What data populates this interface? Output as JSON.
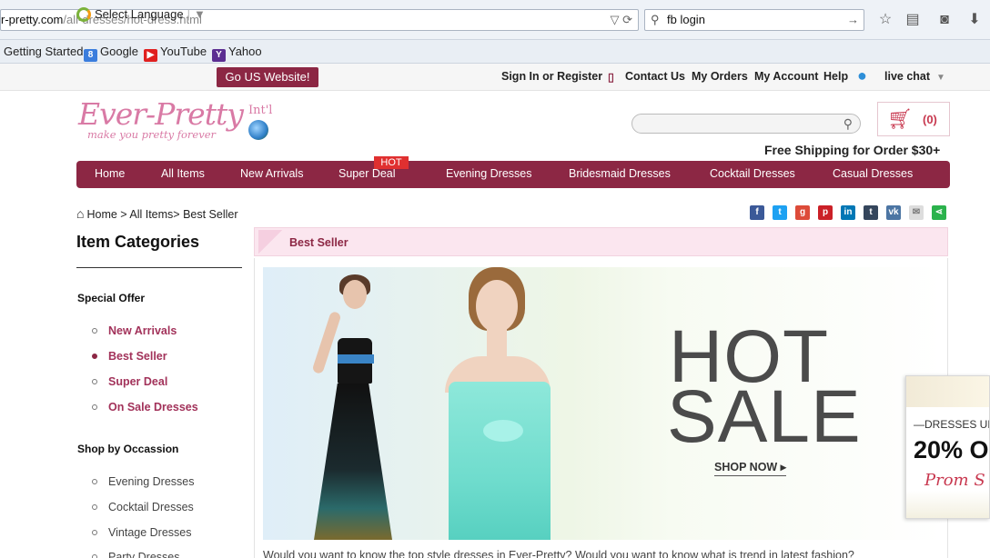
{
  "browser": {
    "url_domain": "r-pretty.com",
    "url_path": "/all-dresses/hot-dress.html",
    "search_value": "fb login",
    "bookmarks": [
      "Getting Started",
      "Google",
      "YouTube",
      "Yahoo"
    ]
  },
  "topbar": {
    "language": "Select Language",
    "go_us": "Go US Website!",
    "sign_in": "Sign In or Register",
    "contact": "Contact Us",
    "orders": "My Orders",
    "account": "My Account",
    "help": "Help",
    "live_chat": "live chat"
  },
  "header": {
    "logo": "Ever-Pretty",
    "logo_suffix": "Int'l",
    "tagline": "make you pretty forever",
    "cart_count": "(0)",
    "free_shipping": "Free Shipping for Order $30+"
  },
  "nav": {
    "items": [
      "Home",
      "All Items",
      "New Arrivals",
      "Super Deal",
      "Evening Dresses",
      "Bridesmaid Dresses",
      "Cocktail Dresses",
      "Casual Dresses"
    ],
    "hot_badge": "HOT"
  },
  "breadcrumb": {
    "home": "Home",
    "rest": " > All Items> Best Seller"
  },
  "sidebar": {
    "title": "Item Categories",
    "special_offer": {
      "title": "Special Offer",
      "items": [
        "New Arrivals",
        "Best Seller",
        "Super Deal",
        "On Sale Dresses"
      ]
    },
    "occasion": {
      "title": "Shop by Occassion",
      "items": [
        "Evening Dresses",
        "Cocktail Dresses",
        "Vintage Dresses",
        "Party Dresses"
      ]
    }
  },
  "main": {
    "section_title": "Best Seller",
    "banner_hot": "HOT",
    "banner_sale": "SALE",
    "shop_now": "SHOP NOW ▸",
    "intro": "Would you want to know the top style dresses in Ever-Pretty? Would you want to know what is trend in latest fashion?"
  },
  "float_ad": {
    "line1": "—DRESSES UP",
    "line2": "20% O",
    "line3": "Prom S"
  },
  "colors": {
    "brand": "#8c2744",
    "brand_pink": "#d97aa5",
    "hot_red": "#e03030"
  }
}
